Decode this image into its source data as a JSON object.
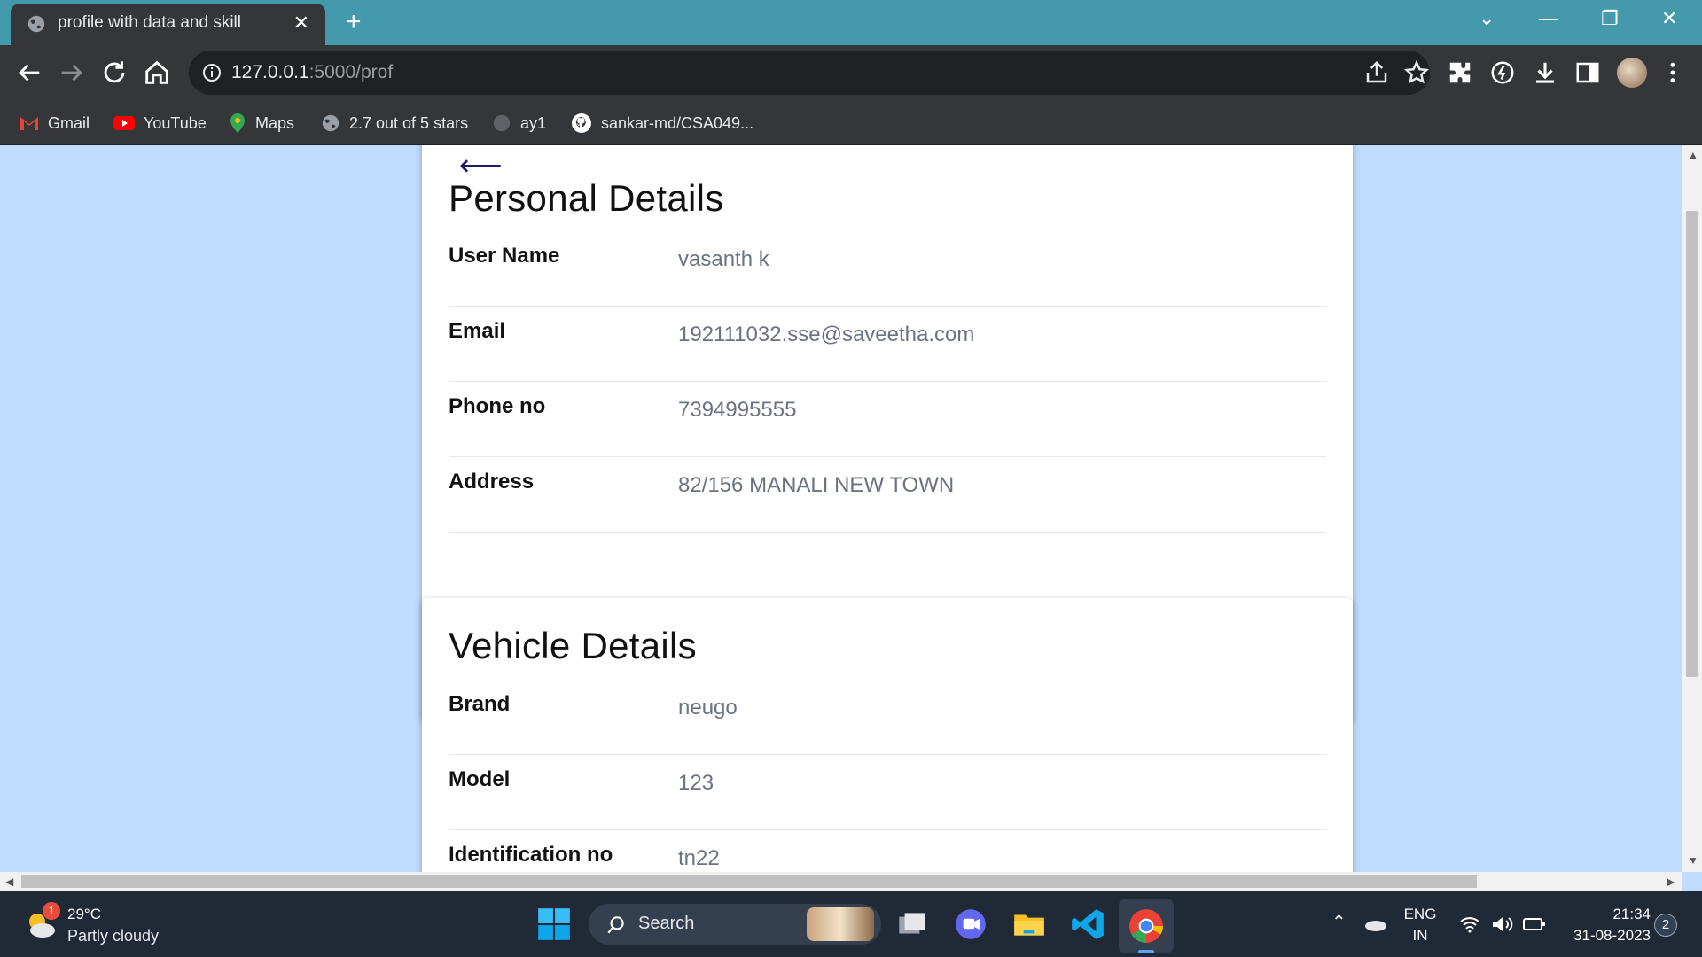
{
  "browser": {
    "tab_title": "profile with data and skill",
    "url_host": "127.0.0.1",
    "url_path": ":5000/prof",
    "bookmarks": [
      "Gmail",
      "YouTube",
      "Maps",
      "2.7 out of 5 stars",
      "ay1",
      "sankar-md/CSA049..."
    ]
  },
  "personal": {
    "title": "Personal Details",
    "rows": [
      {
        "label": "User Name",
        "value": "vasanth k"
      },
      {
        "label": "Email",
        "value": "192111032.sse@saveetha.com"
      },
      {
        "label": "Phone no",
        "value": "7394995555"
      },
      {
        "label": "Address",
        "value": "82/156 MANALI NEW TOWN"
      }
    ]
  },
  "vehicle": {
    "title": "Vehicle Details",
    "rows": [
      {
        "label": "Brand",
        "value": "neugo"
      },
      {
        "label": "Model",
        "value": "123"
      },
      {
        "label": "Identification no",
        "value": "tn22"
      }
    ]
  },
  "taskbar": {
    "weather_temp": "29°C",
    "weather_desc": "Partly cloudy",
    "weather_badge": "1",
    "search_label": "Search",
    "lang_top": "ENG",
    "lang_bottom": "IN",
    "time": "21:34",
    "date": "31-08-2023",
    "notification_count": "2"
  },
  "colors": {
    "page_bg": "#bfdbfe",
    "chrome_dark": "#35363a",
    "tabstrip": "#4599ad",
    "taskbar": "#202a37"
  }
}
